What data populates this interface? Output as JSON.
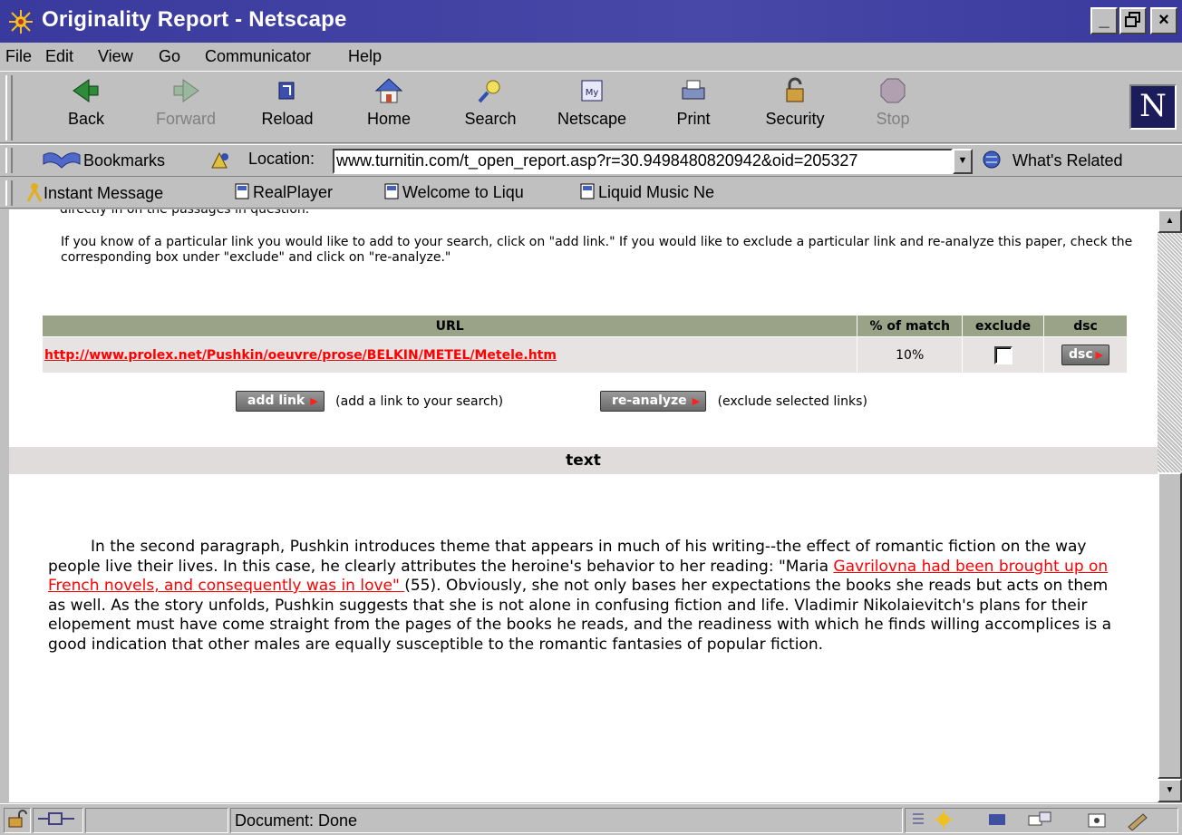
{
  "window": {
    "title": "Originality Report - Netscape",
    "minimize": "_",
    "maximize": "□",
    "close": "×"
  },
  "menu": [
    "File",
    "Edit",
    "View",
    "Go",
    "Communicator",
    "Help"
  ],
  "toolbar": {
    "back": "Back",
    "forward": "Forward",
    "reload": "Reload",
    "home": "Home",
    "search": "Search",
    "netscape": "Netscape",
    "print": "Print",
    "security": "Security",
    "stop": "Stop",
    "logo": "N"
  },
  "location": {
    "bookmarks": "Bookmarks",
    "label": "Location:",
    "url": "www.turnitin.com/t_open_report.asp?r=30.9498480820942&oid=205327",
    "related": "What's Related"
  },
  "personal": [
    "Instant Message",
    "RealPlayer",
    "Welcome to Liqu",
    "Liquid Music Ne"
  ],
  "report": {
    "cut_text": "directly in on the passages in question.",
    "intro": "If you know of a particular link you would like to add to your search, click on \"add link.\" If you would like to exclude a particular link and re-analyze this paper, check the corresponding box under \"exclude\" and click on \"re-analyze.\"",
    "columns": {
      "url": "URL",
      "match": "% of match",
      "exclude": "exclude",
      "dsc": "dsc"
    },
    "rows": [
      {
        "url": "http://www.prolex.net/Pushkin/oeuvre/prose/BELKIN/METEL/Metele.htm",
        "match": "10%",
        "dsc": "dsc"
      }
    ],
    "add_link": "add link",
    "add_link_note": "(add a link to your search)",
    "reanalyze": "re-analyze",
    "reanalyze_note": "(exclude selected links)",
    "text_header": "text"
  },
  "essay": {
    "before": "In the second paragraph, Pushkin introduces theme that appears in much of his writing--the effect of romantic fiction on the way people live their lives. In this case, he clearly attributes the heroine's behavior to her reading: \"Maria ",
    "match": "Gavrilovna had been brought up on French novels, and consequently was in love\" ",
    "after": "(55). Obviously, she not only bases her expectations the books she reads but acts on them as well. As the story unfolds, Pushkin suggests that she is not alone in confusing fiction and life. Vladimir Nikolaievitch's plans for their elopement must have come straight from the pages of the books he reads, and the readiness with which he finds willing accomplices is a good indication that other males are equally susceptible to the romantic fantasies of popular fiction."
  },
  "status": {
    "text": "Document: Done"
  },
  "colors": {
    "titlebar": "#3a3a9e",
    "table_header": "#9aa387",
    "link": "#ff0000",
    "row_bg": "#e8e3e3"
  }
}
